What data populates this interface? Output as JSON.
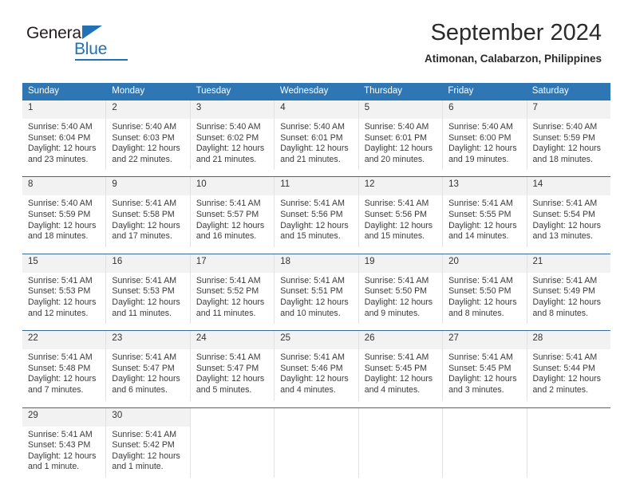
{
  "brand": {
    "name_part1": "General",
    "name_part2": "Blue",
    "accent_color": "#1f72b5"
  },
  "header": {
    "title": "September 2024",
    "subtitle": "Atimonan, Calabarzon, Philippines"
  },
  "theme": {
    "header_bg": "#2f76b4",
    "header_text": "#ffffff",
    "daynum_bg": "#f2f2f2",
    "cell_border": "#e2e2e2",
    "row_border": "#3b6a97"
  },
  "calendar": {
    "weekday_headers": [
      "Sunday",
      "Monday",
      "Tuesday",
      "Wednesday",
      "Thursday",
      "Friday",
      "Saturday"
    ],
    "weeks": [
      [
        {
          "day": "1",
          "lines": [
            "Sunrise: 5:40 AM",
            "Sunset: 6:04 PM",
            "Daylight: 12 hours",
            "and 23 minutes."
          ]
        },
        {
          "day": "2",
          "lines": [
            "Sunrise: 5:40 AM",
            "Sunset: 6:03 PM",
            "Daylight: 12 hours",
            "and 22 minutes."
          ]
        },
        {
          "day": "3",
          "lines": [
            "Sunrise: 5:40 AM",
            "Sunset: 6:02 PM",
            "Daylight: 12 hours",
            "and 21 minutes."
          ]
        },
        {
          "day": "4",
          "lines": [
            "Sunrise: 5:40 AM",
            "Sunset: 6:01 PM",
            "Daylight: 12 hours",
            "and 21 minutes."
          ]
        },
        {
          "day": "5",
          "lines": [
            "Sunrise: 5:40 AM",
            "Sunset: 6:01 PM",
            "Daylight: 12 hours",
            "and 20 minutes."
          ]
        },
        {
          "day": "6",
          "lines": [
            "Sunrise: 5:40 AM",
            "Sunset: 6:00 PM",
            "Daylight: 12 hours",
            "and 19 minutes."
          ]
        },
        {
          "day": "7",
          "lines": [
            "Sunrise: 5:40 AM",
            "Sunset: 5:59 PM",
            "Daylight: 12 hours",
            "and 18 minutes."
          ]
        }
      ],
      [
        {
          "day": "8",
          "lines": [
            "Sunrise: 5:40 AM",
            "Sunset: 5:59 PM",
            "Daylight: 12 hours",
            "and 18 minutes."
          ]
        },
        {
          "day": "9",
          "lines": [
            "Sunrise: 5:41 AM",
            "Sunset: 5:58 PM",
            "Daylight: 12 hours",
            "and 17 minutes."
          ]
        },
        {
          "day": "10",
          "lines": [
            "Sunrise: 5:41 AM",
            "Sunset: 5:57 PM",
            "Daylight: 12 hours",
            "and 16 minutes."
          ]
        },
        {
          "day": "11",
          "lines": [
            "Sunrise: 5:41 AM",
            "Sunset: 5:56 PM",
            "Daylight: 12 hours",
            "and 15 minutes."
          ]
        },
        {
          "day": "12",
          "lines": [
            "Sunrise: 5:41 AM",
            "Sunset: 5:56 PM",
            "Daylight: 12 hours",
            "and 15 minutes."
          ]
        },
        {
          "day": "13",
          "lines": [
            "Sunrise: 5:41 AM",
            "Sunset: 5:55 PM",
            "Daylight: 12 hours",
            "and 14 minutes."
          ]
        },
        {
          "day": "14",
          "lines": [
            "Sunrise: 5:41 AM",
            "Sunset: 5:54 PM",
            "Daylight: 12 hours",
            "and 13 minutes."
          ]
        }
      ],
      [
        {
          "day": "15",
          "lines": [
            "Sunrise: 5:41 AM",
            "Sunset: 5:53 PM",
            "Daylight: 12 hours",
            "and 12 minutes."
          ]
        },
        {
          "day": "16",
          "lines": [
            "Sunrise: 5:41 AM",
            "Sunset: 5:53 PM",
            "Daylight: 12 hours",
            "and 11 minutes."
          ]
        },
        {
          "day": "17",
          "lines": [
            "Sunrise: 5:41 AM",
            "Sunset: 5:52 PM",
            "Daylight: 12 hours",
            "and 11 minutes."
          ]
        },
        {
          "day": "18",
          "lines": [
            "Sunrise: 5:41 AM",
            "Sunset: 5:51 PM",
            "Daylight: 12 hours",
            "and 10 minutes."
          ]
        },
        {
          "day": "19",
          "lines": [
            "Sunrise: 5:41 AM",
            "Sunset: 5:50 PM",
            "Daylight: 12 hours",
            "and 9 minutes."
          ]
        },
        {
          "day": "20",
          "lines": [
            "Sunrise: 5:41 AM",
            "Sunset: 5:50 PM",
            "Daylight: 12 hours",
            "and 8 minutes."
          ]
        },
        {
          "day": "21",
          "lines": [
            "Sunrise: 5:41 AM",
            "Sunset: 5:49 PM",
            "Daylight: 12 hours",
            "and 8 minutes."
          ]
        }
      ],
      [
        {
          "day": "22",
          "lines": [
            "Sunrise: 5:41 AM",
            "Sunset: 5:48 PM",
            "Daylight: 12 hours",
            "and 7 minutes."
          ]
        },
        {
          "day": "23",
          "lines": [
            "Sunrise: 5:41 AM",
            "Sunset: 5:47 PM",
            "Daylight: 12 hours",
            "and 6 minutes."
          ]
        },
        {
          "day": "24",
          "lines": [
            "Sunrise: 5:41 AM",
            "Sunset: 5:47 PM",
            "Daylight: 12 hours",
            "and 5 minutes."
          ]
        },
        {
          "day": "25",
          "lines": [
            "Sunrise: 5:41 AM",
            "Sunset: 5:46 PM",
            "Daylight: 12 hours",
            "and 4 minutes."
          ]
        },
        {
          "day": "26",
          "lines": [
            "Sunrise: 5:41 AM",
            "Sunset: 5:45 PM",
            "Daylight: 12 hours",
            "and 4 minutes."
          ]
        },
        {
          "day": "27",
          "lines": [
            "Sunrise: 5:41 AM",
            "Sunset: 5:45 PM",
            "Daylight: 12 hours",
            "and 3 minutes."
          ]
        },
        {
          "day": "28",
          "lines": [
            "Sunrise: 5:41 AM",
            "Sunset: 5:44 PM",
            "Daylight: 12 hours",
            "and 2 minutes."
          ]
        }
      ],
      [
        {
          "day": "29",
          "lines": [
            "Sunrise: 5:41 AM",
            "Sunset: 5:43 PM",
            "Daylight: 12 hours",
            "and 1 minute."
          ]
        },
        {
          "day": "30",
          "lines": [
            "Sunrise: 5:41 AM",
            "Sunset: 5:42 PM",
            "Daylight: 12 hours",
            "and 1 minute."
          ]
        },
        {
          "day": "",
          "lines": []
        },
        {
          "day": "",
          "lines": []
        },
        {
          "day": "",
          "lines": []
        },
        {
          "day": "",
          "lines": []
        },
        {
          "day": "",
          "lines": []
        }
      ]
    ]
  }
}
